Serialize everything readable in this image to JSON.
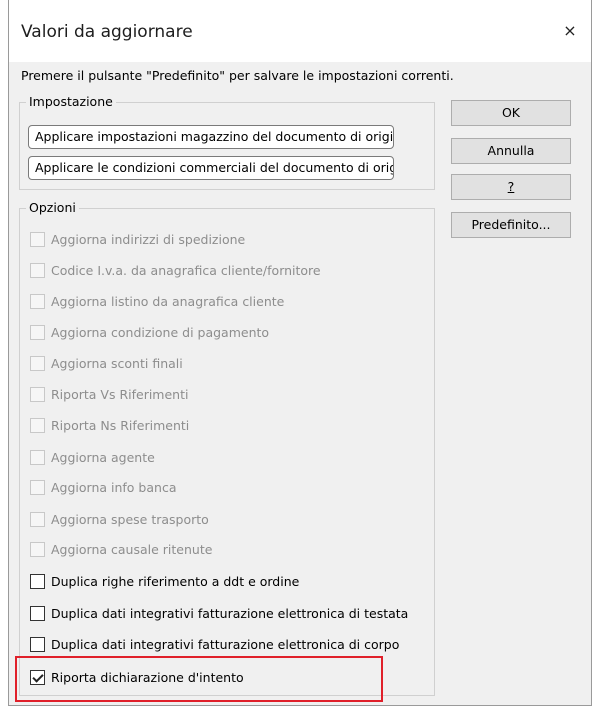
{
  "dialog": {
    "title": "Valori da aggiornare",
    "close_symbol": "×",
    "instruction": "Premere il pulsante \"Predefinito\" per salvare le impostazioni correnti."
  },
  "impostazione": {
    "legend": "Impostazione",
    "items": [
      "Applicare impostazioni magazzino del documento di origine",
      "Applicare le condizioni commerciali del documento di origine"
    ]
  },
  "opzioni": {
    "legend": "Opzioni",
    "items": [
      {
        "label": "Aggiorna indirizzi di spedizione",
        "enabled": false,
        "checked": false
      },
      {
        "label": "Codice I.v.a. da anagrafica cliente/fornitore",
        "enabled": false,
        "checked": false
      },
      {
        "label": "Aggiorna listino da anagrafica cliente",
        "enabled": false,
        "checked": false
      },
      {
        "label": "Aggiorna condizione di pagamento",
        "enabled": false,
        "checked": false
      },
      {
        "label": "Aggiorna sconti finali",
        "enabled": false,
        "checked": false
      },
      {
        "label": "Riporta Vs Riferimenti",
        "enabled": false,
        "checked": false
      },
      {
        "label": "Riporta Ns Riferimenti",
        "enabled": false,
        "checked": false
      },
      {
        "label": "Aggiorna agente",
        "enabled": false,
        "checked": false
      },
      {
        "label": "Aggiorna info banca",
        "enabled": false,
        "checked": false
      },
      {
        "label": "Aggiorna spese trasporto",
        "enabled": false,
        "checked": false
      },
      {
        "label": "Aggiorna causale ritenute",
        "enabled": false,
        "checked": false
      },
      {
        "label": "Duplica righe riferimento a ddt e ordine",
        "enabled": true,
        "checked": false
      },
      {
        "label": "Duplica dati integrativi fatturazione elettronica di testata",
        "enabled": true,
        "checked": false
      },
      {
        "label": "Duplica dati integrativi fatturazione elettronica di corpo",
        "enabled": true,
        "checked": false
      },
      {
        "label": "Riporta dichiarazione d'intento",
        "enabled": true,
        "checked": true
      }
    ]
  },
  "buttons": {
    "ok": "OK",
    "annulla": "Annulla",
    "help": "?",
    "predefinito": "Predefinito..."
  },
  "colors": {
    "highlight": "#e0202a"
  }
}
